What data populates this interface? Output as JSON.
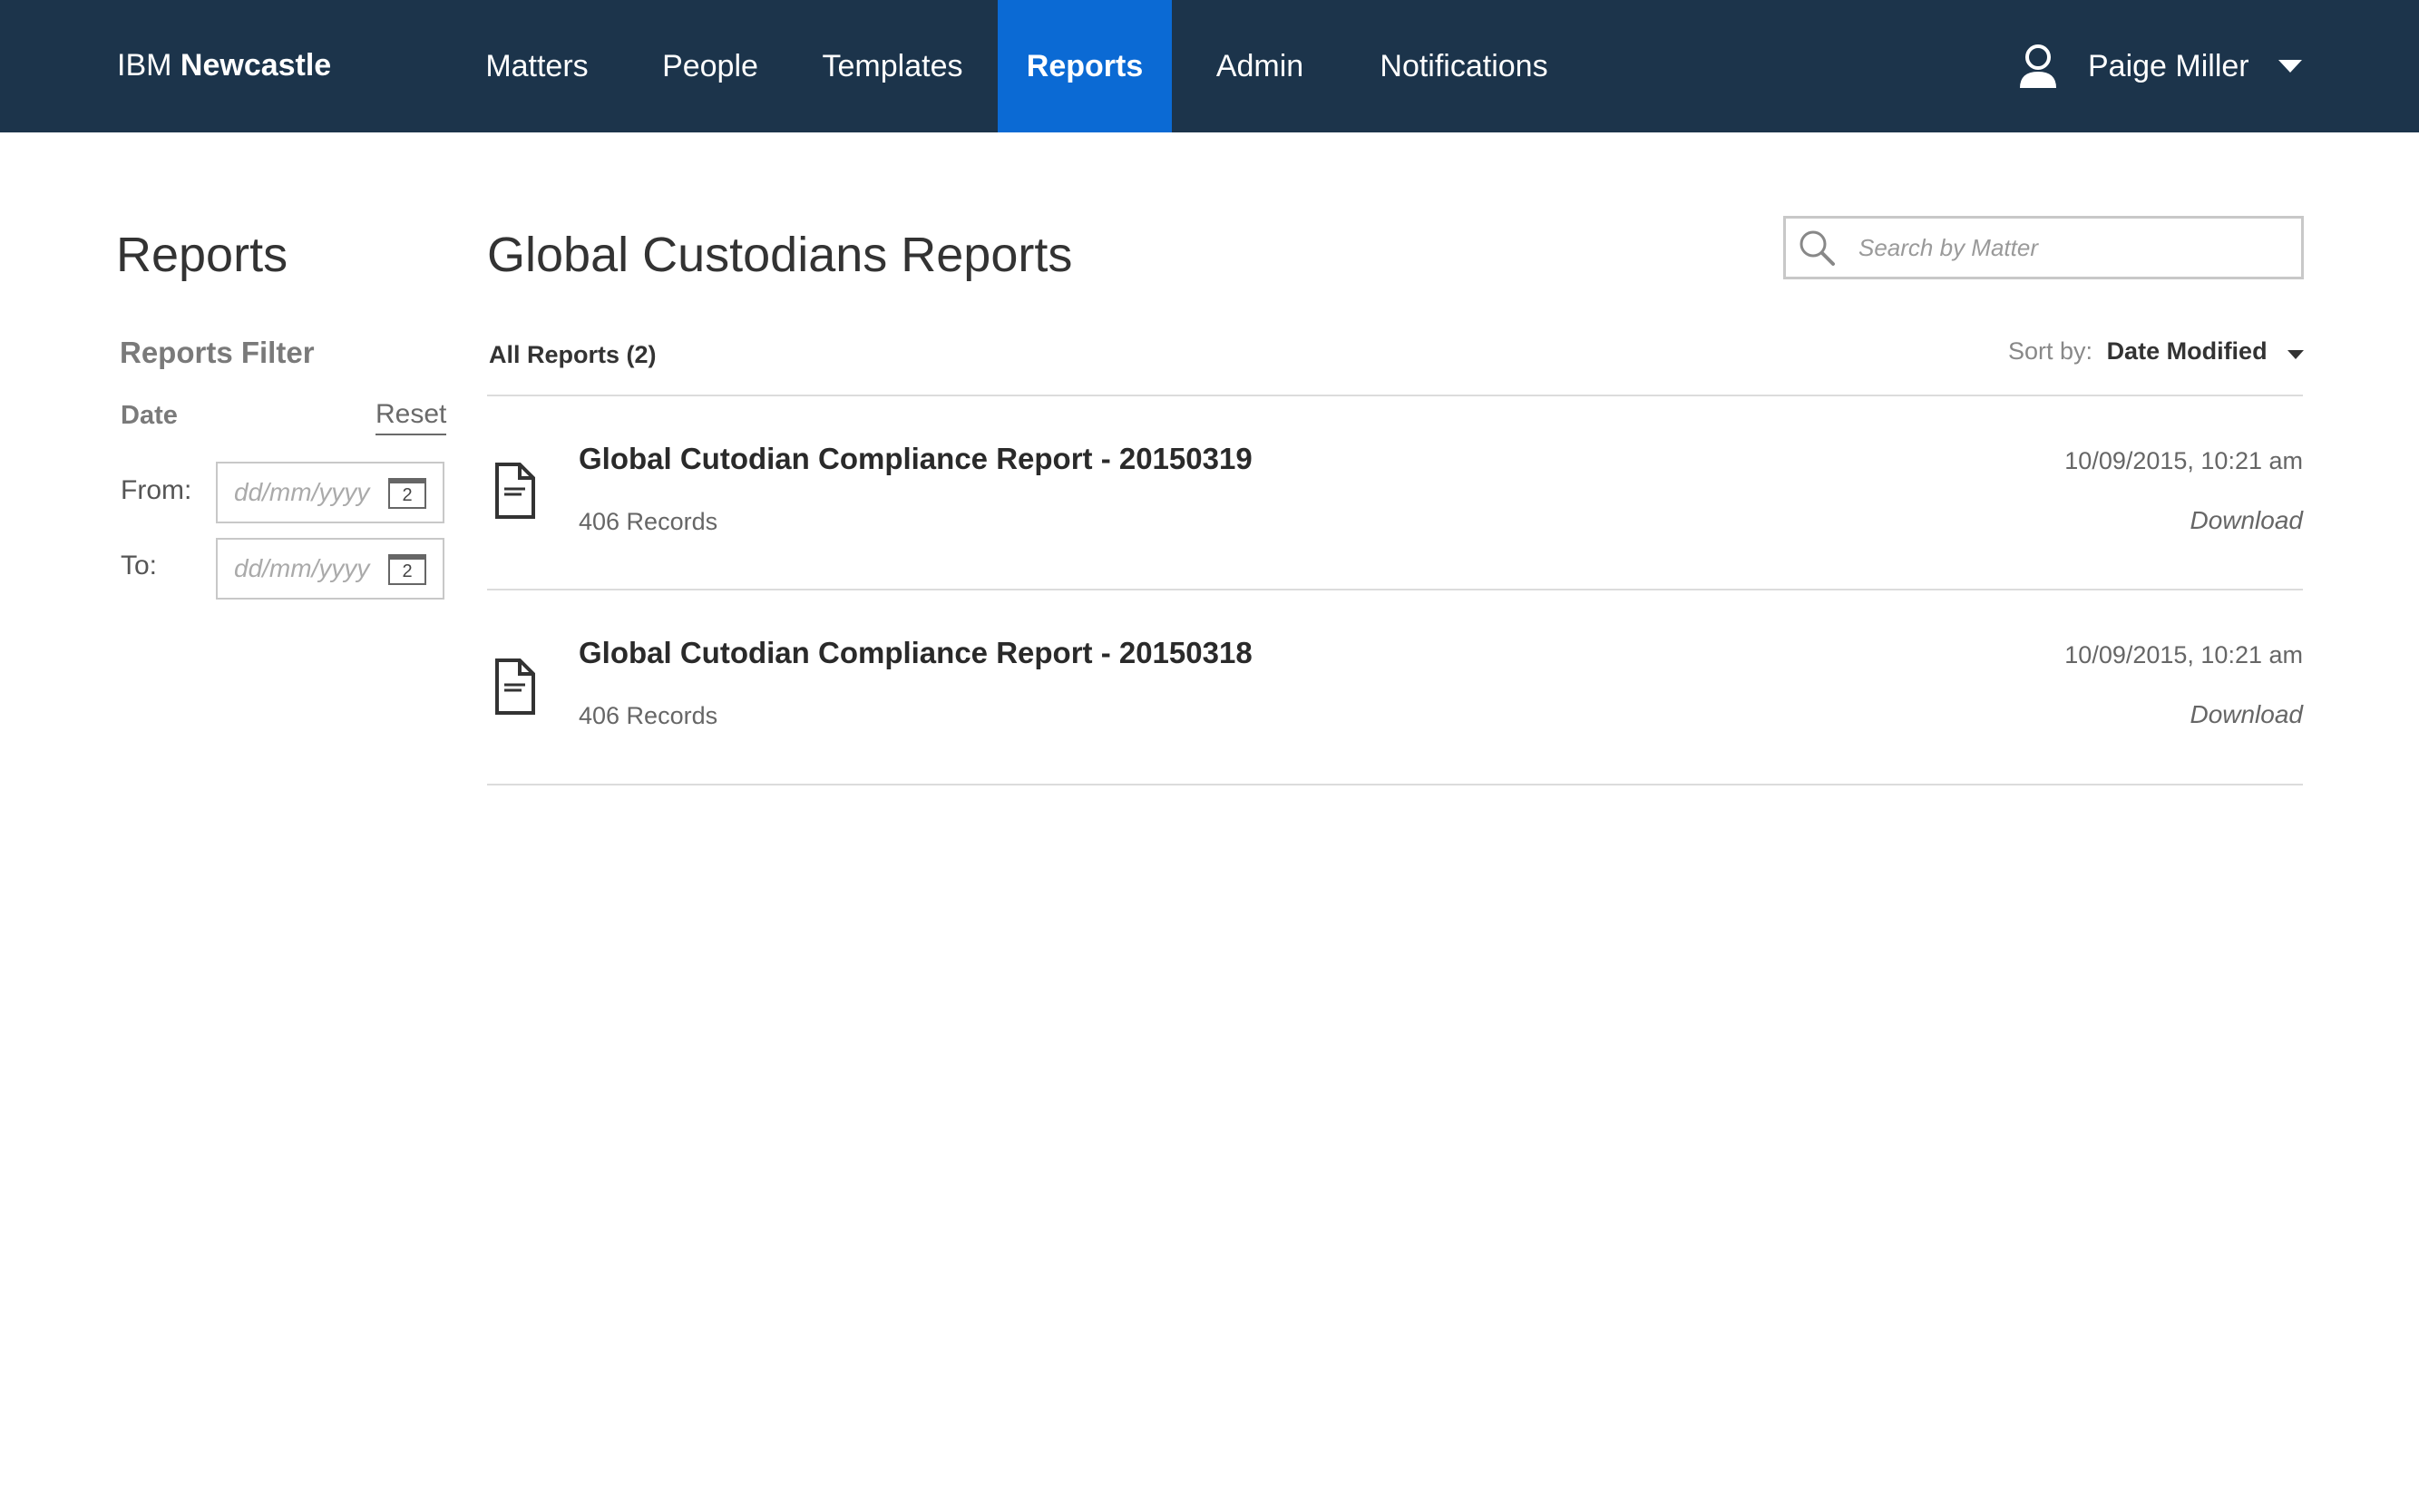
{
  "header": {
    "brand_prefix": "IBM",
    "brand_name": "Newcastle",
    "nav": [
      {
        "label": "Matters",
        "active": false
      },
      {
        "label": "People",
        "active": false
      },
      {
        "label": "Templates",
        "active": false
      },
      {
        "label": "Reports",
        "active": true
      },
      {
        "label": "Admin",
        "active": false
      },
      {
        "label": "Notifications",
        "active": false
      }
    ],
    "user": {
      "name": "Paige Miller",
      "icon": "user-icon",
      "menu_icon": "chevron-down-icon"
    }
  },
  "sidebar": {
    "title": "Reports",
    "filter_title": "Reports Filter",
    "date_label": "Date",
    "reset_label": "Reset",
    "from_label": "From:",
    "to_label": "To:",
    "from_placeholder": "dd/mm/yyyy",
    "to_placeholder": "dd/mm/yyyy",
    "calendar_icon_text": "2"
  },
  "main": {
    "title": "Global Custodians Reports",
    "search_placeholder": "Search by Matter",
    "list_count_label": "All Reports (2)",
    "sort_label": "Sort by:",
    "sort_value": "Date Modified",
    "reports": [
      {
        "title": "Global Cutodian Compliance Report - 20150319",
        "records": "406 Records",
        "date": "10/09/2015, 10:21 am",
        "action": "Download"
      },
      {
        "title": "Global Cutodian Compliance Report - 20150318",
        "records": "406 Records",
        "date": "10/09/2015, 10:21 am",
        "action": "Download"
      }
    ]
  },
  "colors": {
    "header_bg": "#1c344b",
    "active_tab": "#0b6ad4"
  }
}
